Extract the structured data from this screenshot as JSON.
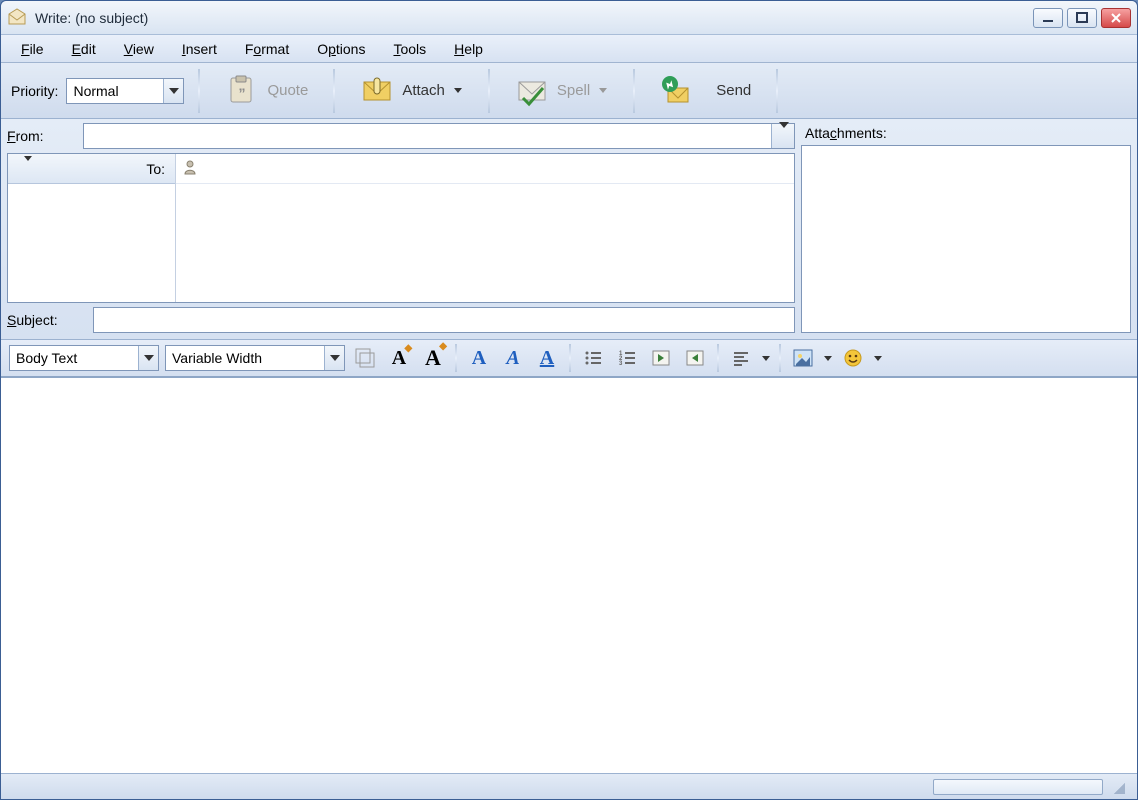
{
  "window": {
    "title": "Write: (no subject)"
  },
  "menu": {
    "file": "File",
    "edit": "Edit",
    "view": "View",
    "insert": "Insert",
    "format": "Format",
    "options": "Options",
    "tools": "Tools",
    "help": "Help"
  },
  "toolbar": {
    "priority_label": "Priority:",
    "priority_value": "Normal",
    "quote": "Quote",
    "attach": "Attach",
    "spell": "Spell",
    "send": "Send"
  },
  "header": {
    "from_label": "From:",
    "to_label": "To:",
    "subject_label": "Subject:",
    "attachments_label": "Attachments:",
    "from_value": "",
    "subject_value": ""
  },
  "format": {
    "para_style": "Body Text",
    "font_family": "Variable Width"
  }
}
